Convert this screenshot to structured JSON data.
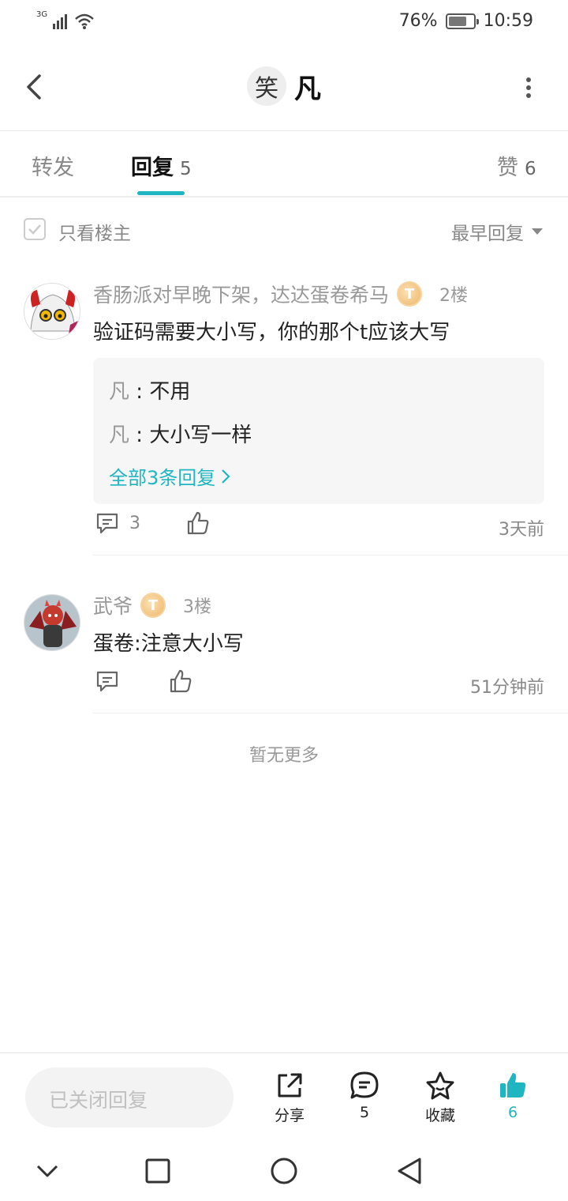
{
  "status_bar": {
    "network": "3G",
    "battery_text": "76%",
    "battery_level": 0.76,
    "time": "10:59"
  },
  "header": {
    "avatar_char": "笑",
    "title": "凡"
  },
  "tabs": [
    {
      "label": "转发",
      "count": ""
    },
    {
      "label": "回复",
      "count": "5"
    },
    {
      "label": "赞",
      "count": "6"
    }
  ],
  "filter": {
    "only_op_label": "只看楼主",
    "sort_label": "最早回复"
  },
  "comments": [
    {
      "author": "香肠派对早晚下架，达达蛋卷希马",
      "badge": "T",
      "floor": "2楼",
      "content": "验证码需要大小写，你的那个t应该大写",
      "replies": [
        {
          "author": "凡",
          "sep": " : ",
          "text": "不用"
        },
        {
          "author": "凡",
          "sep": " : ",
          "text": "大小写一样"
        }
      ],
      "all_replies_label": "全部3条回复",
      "reply_count": "3",
      "time": "3天前"
    },
    {
      "author": "武爷",
      "badge": "T",
      "floor": "3楼",
      "content": "蛋卷:注意大小写",
      "reply_count": "",
      "time": "51分钟前"
    }
  ],
  "no_more": "暂无更多",
  "bottom_bar": {
    "input_placeholder": "已关闭回复",
    "share_label": "分享",
    "comment_count": "5",
    "favorite_label": "收藏",
    "like_count": "6",
    "accent_color": "#1fb6c1"
  }
}
